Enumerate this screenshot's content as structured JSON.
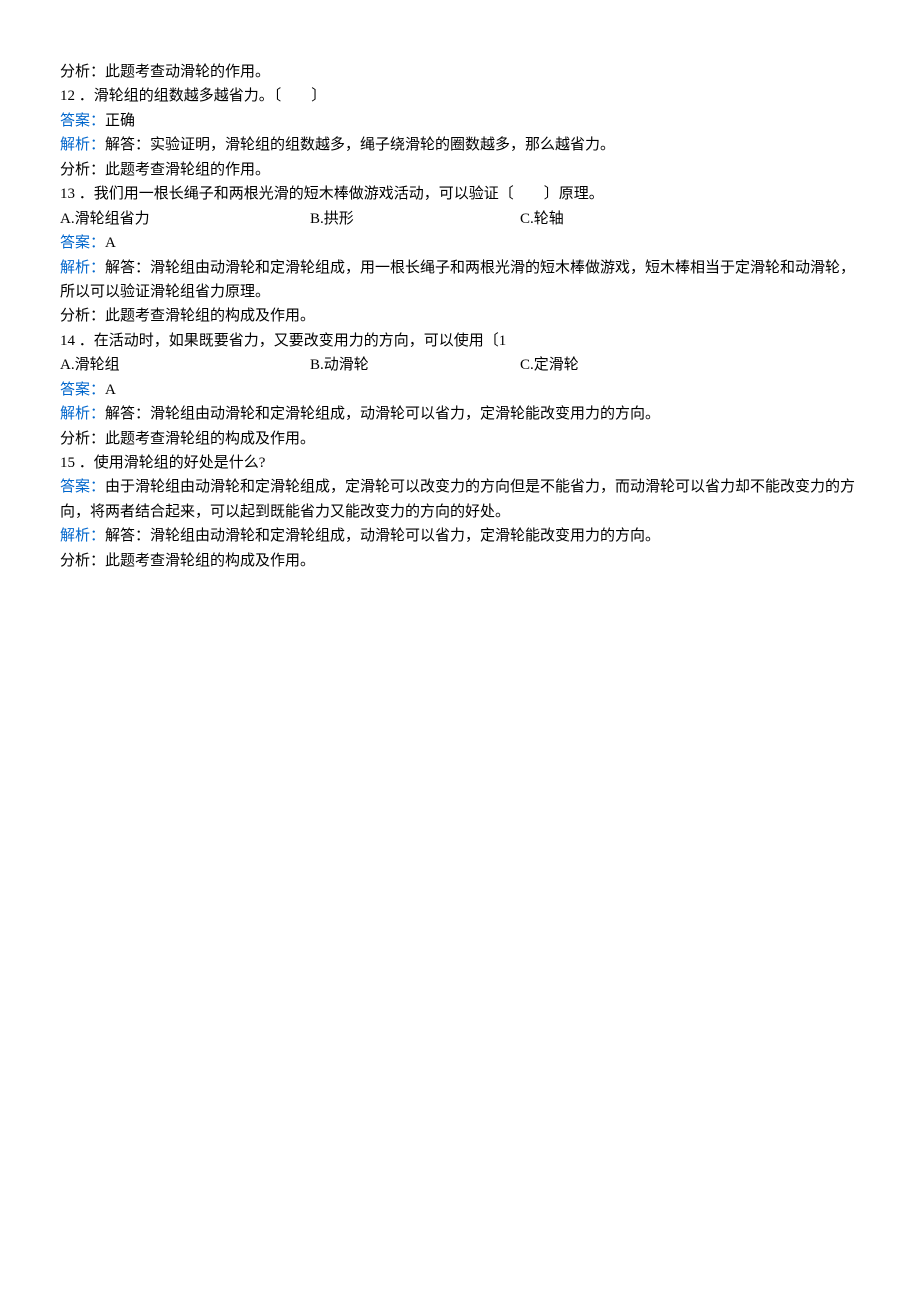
{
  "analysis_prev": "分析：此题考查动滑轮的作用。",
  "q12": {
    "text": "12 ．滑轮组的组数越多越省力。〔　　〕",
    "answer_label": "答案：",
    "answer_text": "正确",
    "explain_label": "解析：",
    "explain_text": "解答：实验证明，滑轮组的组数越多，绳子绕滑轮的圈数越多，那么越省力。",
    "analysis": "分析：此题考查滑轮组的作用。"
  },
  "q13": {
    "text": "13 ．我们用一根长绳子和两根光滑的短木棒做游戏活动，可以验证〔　　〕原理。",
    "opt_a": "A.滑轮组省力",
    "opt_b": "B.拱形",
    "opt_c": "C.轮轴",
    "answer_label": "答案：",
    "answer_text": "A",
    "explain_label": "解析：",
    "explain_text": "解答：滑轮组由动滑轮和定滑轮组成，用一根长绳子和两根光滑的短木棒做游戏，短木棒相当于定滑轮和动滑轮，所以可以验证滑轮组省力原理。",
    "analysis": "分析：此题考查滑轮组的构成及作用。"
  },
  "q14": {
    "text": "14 ．在活动时，如果既要省力，又要改变用力的方向，可以使用〔1",
    "opt_a": "A.滑轮组",
    "opt_b": "B.动滑轮",
    "opt_c": "C.定滑轮",
    "answer_label": "答案：",
    "answer_text": "A",
    "explain_label": "解析：",
    "explain_text": "解答：滑轮组由动滑轮和定滑轮组成，动滑轮可以省力，定滑轮能改变用力的方向。",
    "analysis": "分析：此题考查滑轮组的构成及作用。"
  },
  "q15": {
    "text": "15 ．使用滑轮组的好处是什么?",
    "answer_label": "答案：",
    "answer_text": "由于滑轮组由动滑轮和定滑轮组成，定滑轮可以改变力的方向但是不能省力，而动滑轮可以省力却不能改变力的方向，将两者结合起来，可以起到既能省力又能改变力的方向的好处。",
    "explain_label": "解析：",
    "explain_text": "解答：滑轮组由动滑轮和定滑轮组成，动滑轮可以省力，定滑轮能改变用力的方向。",
    "analysis": "分析：此题考查滑轮组的构成及作用。"
  }
}
